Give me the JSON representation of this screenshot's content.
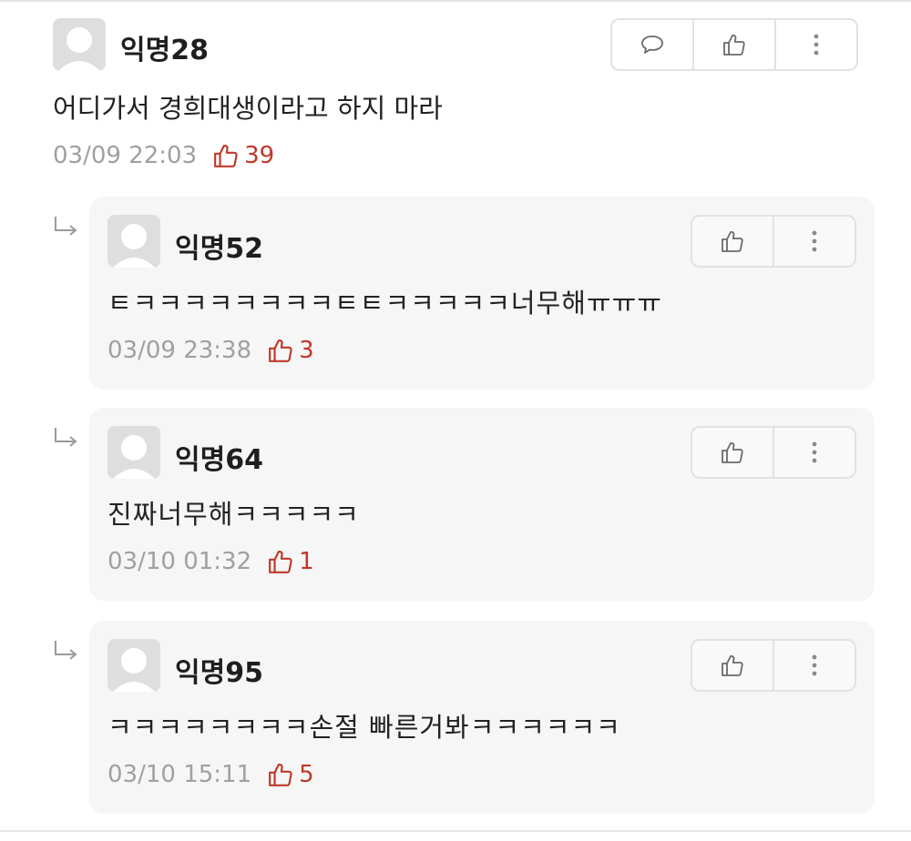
{
  "comment": {
    "author": "익명28",
    "text": "어디가서 경희대생이라고 하지 마라",
    "timestamp": "03/09 22:03",
    "likes": "39"
  },
  "replies": [
    {
      "author": "익명52",
      "text": "ㅌㅋㅋㅋㅋㅋㅋㅋㅋㅌㅌㅋㅋㅋㅋㅋ너무해ㅠㅠㅠ",
      "timestamp": "03/09 23:38",
      "likes": "3"
    },
    {
      "author": "익명64",
      "text": "진짜너무해ㅋㅋㅋㅋㅋ",
      "timestamp": "03/10 01:32",
      "likes": "1"
    },
    {
      "author": "익명95",
      "text": "ㅋㅋㅋㅋㅋㅋㅋㅋ손절 빠른거봐ㅋㅋㅋㅋㅋㅋ",
      "timestamp": "03/10 15:11",
      "likes": "5"
    }
  ],
  "icons": {
    "reply": "speech-bubble-icon",
    "like": "thumbs-up-icon",
    "more": "vertical-dots-icon",
    "reply_indicator": "reply-arrow-icon"
  },
  "colors": {
    "like_accent": "#c0382b",
    "meta_gray": "#a0a0a0",
    "reply_background": "#f6f6f6"
  }
}
